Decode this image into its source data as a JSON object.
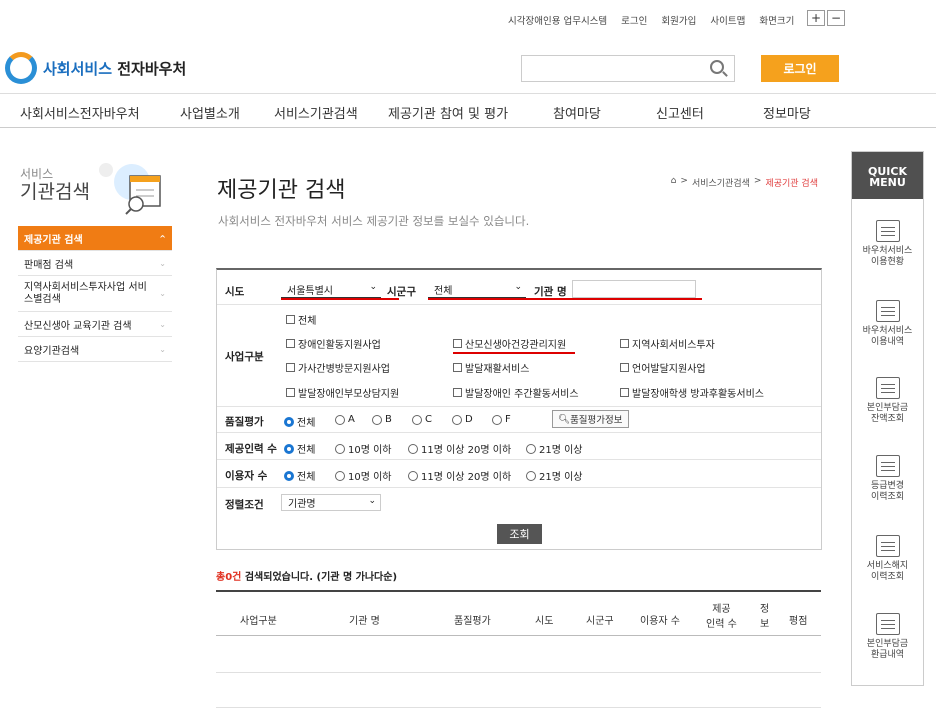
{
  "utility": {
    "links": [
      "시각장애인용 업무시스템",
      "로그인",
      "회원가입",
      "사이트맵"
    ],
    "font_size_label": "화면크기",
    "plus": "+",
    "minus": "−"
  },
  "logo": {
    "part1": "사회서비스",
    "part2": "전자바우처"
  },
  "header": {
    "search_placeholder": "",
    "login_label": "로그인"
  },
  "gnb": [
    "사회서비스전자바우처",
    "사업별소개",
    "서비스기관검색",
    "제공기관 참여 및 평가",
    "참여마당",
    "신고센터",
    "정보마당"
  ],
  "sidebar": {
    "title_small": "서비스",
    "title_big": "기관검색",
    "items": [
      {
        "label": "제공기관 검색",
        "chev": "^"
      },
      {
        "label": "판매점 검색",
        "chev": "⌄"
      },
      {
        "label": "지역사회서비스투자사업 서비스별검색",
        "chev": "⌄"
      },
      {
        "label": "산모신생아 교육기관 검색",
        "chev": "⌄"
      },
      {
        "label": "요양기관검색",
        "chev": "⌄"
      }
    ]
  },
  "page": {
    "title": "제공기관 검색",
    "desc": "사회서비스 전자바우처 서비스 제공기관 정보를 보실수 있습니다.",
    "breadcrumb": [
      "⌂",
      ">",
      "서비스기관검색",
      ">",
      "제공기관 검색"
    ]
  },
  "form": {
    "sido_label": "시도",
    "sido_value": "서울특별시",
    "sigungu_label": "시군구",
    "sigungu_value": "전체",
    "name_label": "기관 명",
    "name_value": "",
    "biz_label": "사업구분",
    "biz_items": [
      "전체",
      "장애인활동지원사업",
      "산모신생아건강관리지원",
      "지역사회서비스투자",
      "가사간병방문지원사업",
      "발달재활서비스",
      "언어발달지원사업",
      "발달장애인부모상담지원",
      "발달장애인 주간활동서비스",
      "발달장애학생 방과후활동서비스"
    ],
    "quality_label": "품질평가",
    "quality_options": [
      "전체",
      "A",
      "B",
      "C",
      "D",
      "F"
    ],
    "quality_btn": "품질평가정보",
    "staff_label": "제공인력 수",
    "staff_options": [
      "전체",
      "10명 이하",
      "11명 이상 20명 이하",
      "21명 이상"
    ],
    "users_label": "이용자 수",
    "users_options": [
      "전체",
      "10명 이하",
      "11명 이상 20명 이하",
      "21명 이상"
    ],
    "sort_label": "정렬조건",
    "sort_value": "기관명",
    "search_btn": "조회"
  },
  "result": {
    "count": "총0건",
    "text": " 검색되었습니다. (기관 명 가나다순)"
  },
  "table": {
    "headers": [
      "사업구분",
      "기관 명",
      "품질평가",
      "시도",
      "시군구",
      "이용자 수",
      "제공\n인력 수",
      "정\n보",
      "평점"
    ],
    "h_staff1": "제공",
    "h_staff2": "인력 수",
    "h_info1": "정",
    "h_info2": "보"
  },
  "quick": {
    "title1": "QUICK",
    "title2": "MENU",
    "items": [
      {
        "l1": "바우처서비스",
        "l2": "이용현황",
        "icon": "chart-icon"
      },
      {
        "l1": "바우처서비스",
        "l2": "이용내역",
        "icon": "document-icon"
      },
      {
        "l1": "본인부담금",
        "l2": "잔액조회",
        "icon": "search-doc-icon"
      },
      {
        "l1": "등급변경",
        "l2": "이력조회",
        "icon": "edit-doc-icon"
      },
      {
        "l1": "서비스해지",
        "l2": "이력조회",
        "icon": "person-icon"
      },
      {
        "l1": "본인부담금",
        "l2": "환급내역",
        "icon": "coin-doc-icon"
      }
    ]
  }
}
